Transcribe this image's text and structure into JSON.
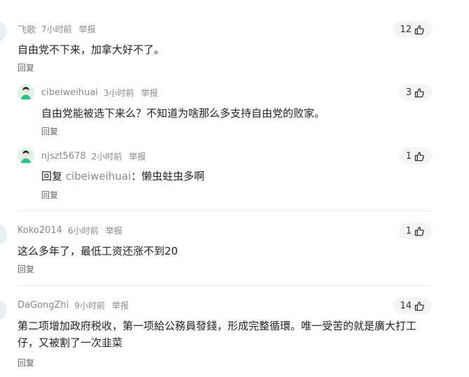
{
  "comments": [
    {
      "user": "飞歌",
      "time": "7小时前",
      "report": "举报",
      "likes": "12",
      "text": "自由党不下来，加拿大好不了。",
      "reply_label": "回复",
      "replies": [
        {
          "user": "cibeiweihuai",
          "time": "3小时前",
          "report": "举报",
          "likes": "3",
          "text": "自由党能被选下来么？不知道为啥那么多支持自由党的败家。",
          "reply_label": "回复"
        },
        {
          "user": "njszt5678",
          "time": "2小时前",
          "report": "举报",
          "likes": "1",
          "text_prefix": "回复",
          "reply_to": "cibeiweihuai",
          "text_suffix": "：懒虫蛀虫多啊",
          "reply_label": "回复"
        }
      ]
    },
    {
      "user": "Koko2014",
      "time": "6小时前",
      "report": "举报",
      "likes": "1",
      "text": "这么多年了，最低工资还涨不到20",
      "reply_label": "回复"
    },
    {
      "user": "DaGongZhi",
      "time": "9小时前",
      "report": "举报",
      "likes": "14",
      "text": "第二项增加政府税收，第一项給公務員發錢，形成完整循環。唯一受苦的就是廣大打工仔，又被割了一次韭菜",
      "reply_label": "回复"
    }
  ],
  "icons": {
    "like": "thumbs-up-icon",
    "avatar": "default-avatar-icon"
  },
  "colors": {
    "muted_text": "#8a8a8a",
    "pill_bg": "#f4f4f4",
    "avatar_bg": "#dff3ea",
    "avatar_accent": "#2bbf85"
  }
}
